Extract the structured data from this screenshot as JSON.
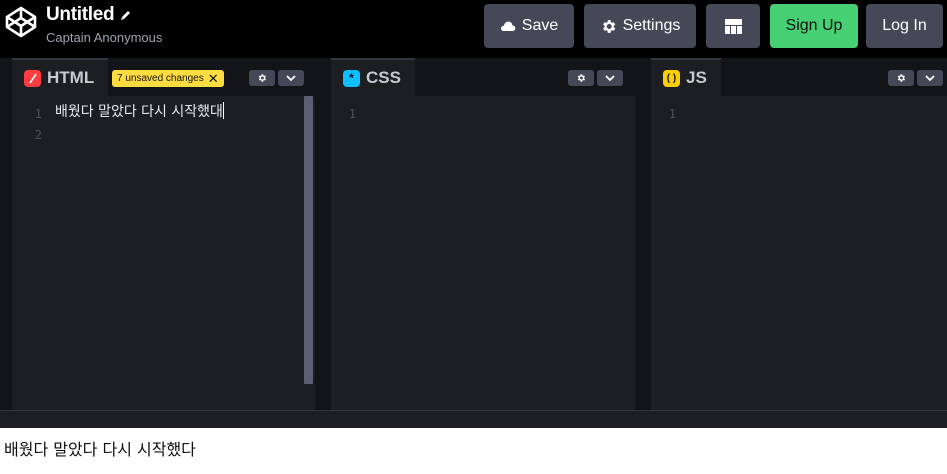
{
  "header": {
    "title": "Untitled",
    "author": "Captain Anonymous",
    "buttons": {
      "save": "Save",
      "settings": "Settings",
      "sign_up": "Sign Up",
      "log_in": "Log In"
    }
  },
  "panes": {
    "html": {
      "name": "HTML",
      "icon": "html-icon",
      "badge": "7 unsaved changes",
      "line_numbers": [
        "1",
        "2"
      ],
      "content": "배웠다 말았다 다시 시작했대"
    },
    "css": {
      "name": "CSS",
      "icon": "css-icon",
      "line_numbers": [
        "1"
      ],
      "content": ""
    },
    "js": {
      "name": "JS",
      "icon": "js-icon",
      "line_numbers": [
        "1"
      ],
      "content": ""
    }
  },
  "preview": {
    "text": "배웠다 말았다 다시 시작했다"
  },
  "colors": {
    "html_accent": "#ff3c41",
    "css_accent": "#0ebeff",
    "js_accent": "#fcd000",
    "sign_up_bg": "#47cf73",
    "badge_bg": "#ffdd40"
  }
}
